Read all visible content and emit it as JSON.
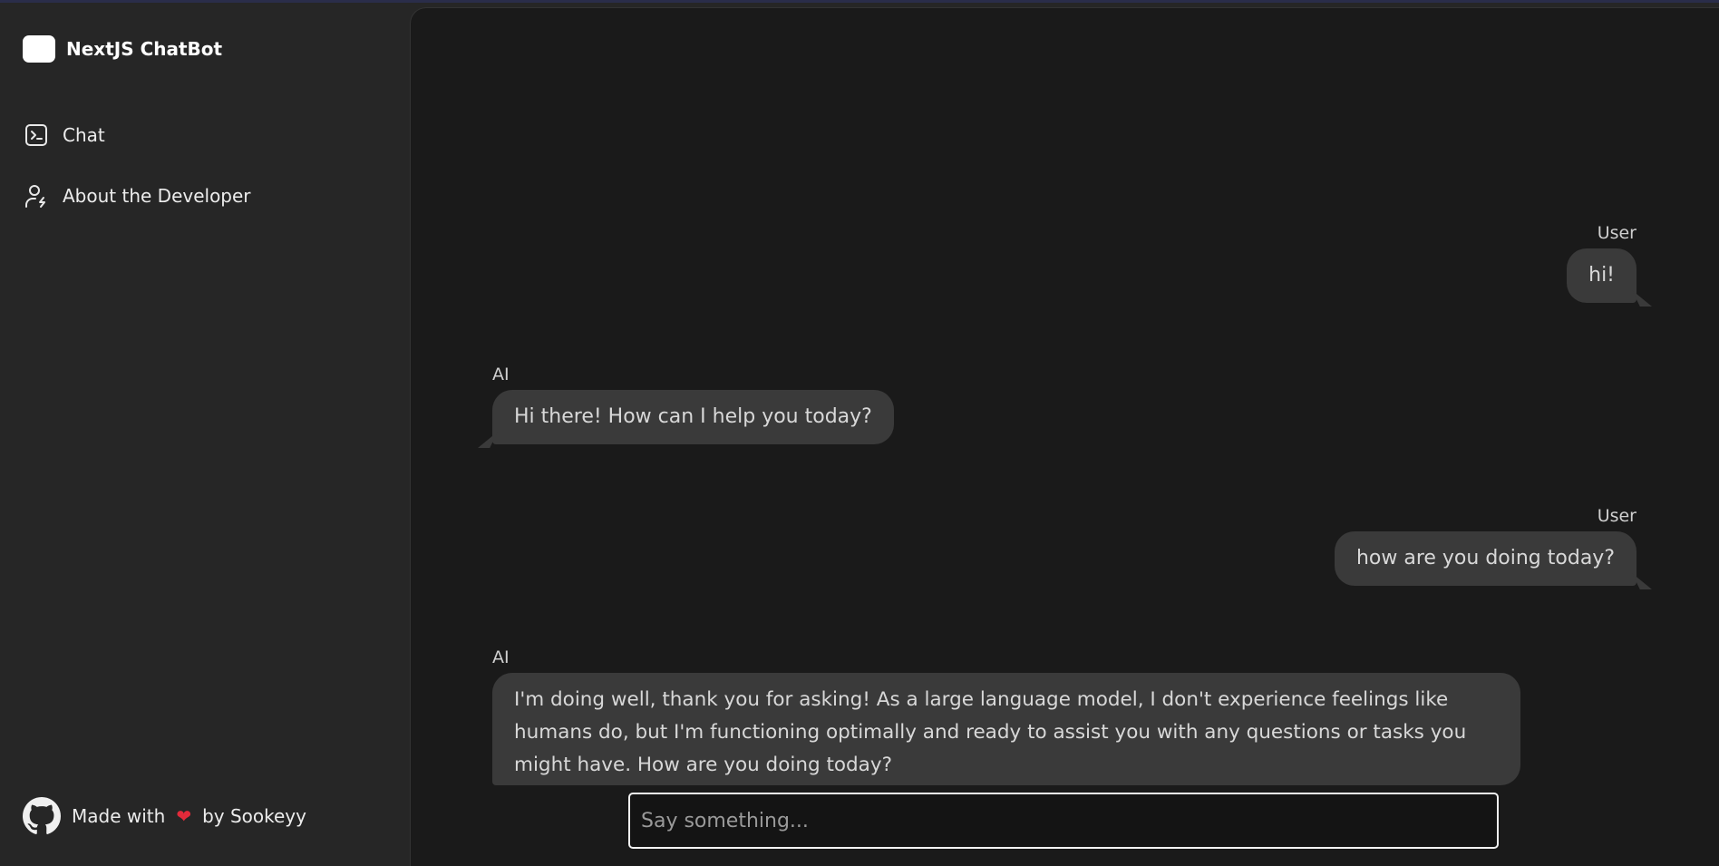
{
  "app": {
    "name": "NextJS ChatBot"
  },
  "sidebar": {
    "items": [
      {
        "label": "Chat",
        "icon": "terminal-square-icon"
      },
      {
        "label": "About the Developer",
        "icon": "user-bolt-icon"
      }
    ],
    "footer": {
      "prefix": "Made with",
      "heart": "❤",
      "suffix": "by Sookeyy",
      "icon": "github-icon"
    }
  },
  "chat": {
    "messages": [
      {
        "role_label": "User",
        "text": "hi!"
      },
      {
        "role_label": "AI",
        "text": "Hi there! How can I help you today?"
      },
      {
        "role_label": "User",
        "text": "how are you doing today?"
      },
      {
        "role_label": "AI",
        "text": "I'm doing well, thank you for asking! As a large language model, I don't experience feelings like humans do, but I'm functioning optimally and ready to assist you with any questions or tasks you might have. How are you doing today?"
      }
    ],
    "input": {
      "placeholder": "Say something...",
      "value": ""
    }
  },
  "colors": {
    "sidebar_bg": "#262626",
    "main_bg": "#1a1a1a",
    "bubble_bg": "#3a3a3a",
    "heart": "#e22a3a"
  }
}
